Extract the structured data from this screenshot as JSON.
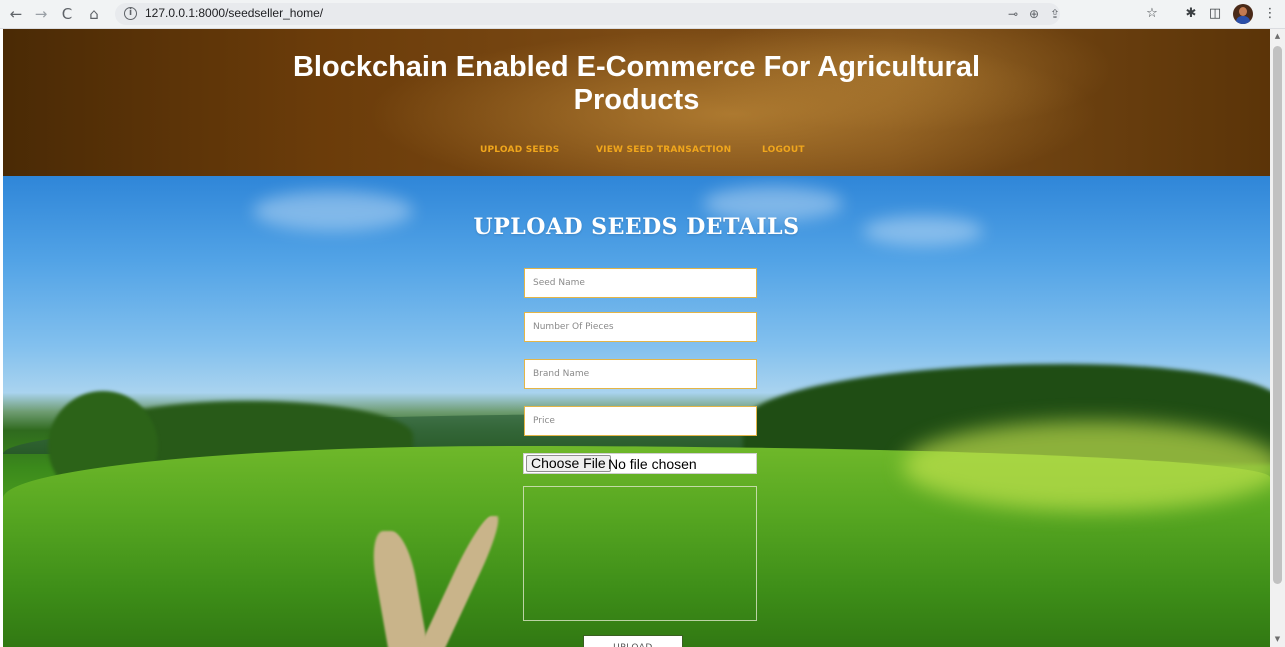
{
  "browser": {
    "url": "127.0.0.1:8000/seedseller_home/",
    "back_glyph": "←",
    "forward_glyph": "→",
    "reload_glyph": "C",
    "home_glyph": "⌂",
    "info_glyph": "i",
    "key_glyph": "⊸",
    "zoom_glyph": "⊕",
    "share_glyph": "⇪",
    "star_glyph": "☆",
    "extensions_glyph": "✱",
    "sidepanel_glyph": "◫",
    "menu_glyph": "⋮"
  },
  "header": {
    "title_line1": "Blockchain Enabled E-Commerce For Agricultural",
    "title_line2": "Products",
    "nav": [
      {
        "label": "UPLOAD SEEDS"
      },
      {
        "label": "VIEW SEED TRANSACTION"
      },
      {
        "label": "LOGOUT"
      }
    ]
  },
  "form": {
    "title": "UPLOAD SEEDS DETAILS",
    "seed_name_placeholder": "Seed Name",
    "pieces_placeholder": "Number Of Pieces",
    "brand_placeholder": "Brand Name",
    "price_placeholder": "Price",
    "file_button": "Choose File",
    "file_status": "No file chosen",
    "submit_label": "UPLOAD"
  },
  "colors": {
    "nav_link": "#f0a61c",
    "field_border": "#e3b548",
    "header_brown": "#6b3c0a"
  },
  "scrollbar": {
    "up_glyph": "▲",
    "down_glyph": "▼"
  }
}
